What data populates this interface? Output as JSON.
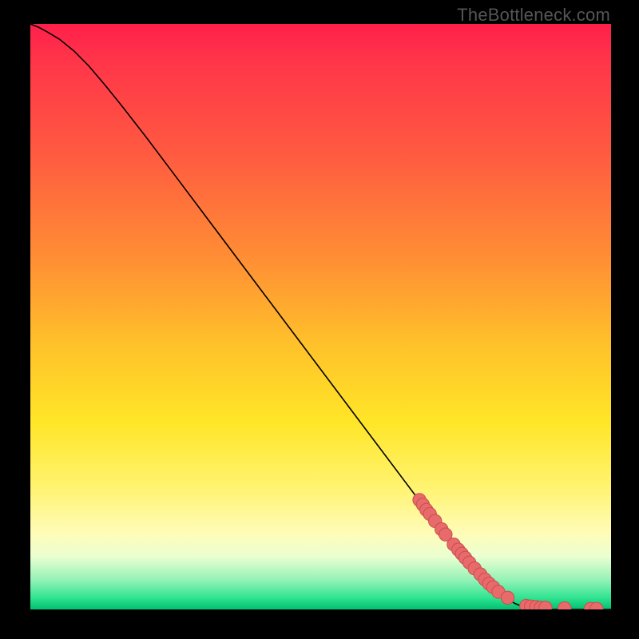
{
  "watermark": "TheBottleneck.com",
  "chart_data": {
    "type": "line",
    "title": "",
    "xlabel": "",
    "ylabel": "",
    "xlim": [
      0,
      1
    ],
    "ylim": [
      0,
      1
    ],
    "curve": [
      {
        "x": 0.0,
        "y": 1.0
      },
      {
        "x": 0.015,
        "y": 0.994
      },
      {
        "x": 0.03,
        "y": 0.986
      },
      {
        "x": 0.05,
        "y": 0.974
      },
      {
        "x": 0.075,
        "y": 0.954
      },
      {
        "x": 0.1,
        "y": 0.929
      },
      {
        "x": 0.13,
        "y": 0.894
      },
      {
        "x": 0.16,
        "y": 0.857
      },
      {
        "x": 0.2,
        "y": 0.806
      },
      {
        "x": 0.25,
        "y": 0.74
      },
      {
        "x": 0.3,
        "y": 0.674
      },
      {
        "x": 0.35,
        "y": 0.608
      },
      {
        "x": 0.4,
        "y": 0.542
      },
      {
        "x": 0.45,
        "y": 0.476
      },
      {
        "x": 0.5,
        "y": 0.41
      },
      {
        "x": 0.55,
        "y": 0.344
      },
      {
        "x": 0.6,
        "y": 0.278
      },
      {
        "x": 0.65,
        "y": 0.212
      },
      {
        "x": 0.7,
        "y": 0.146
      },
      {
        "x": 0.73,
        "y": 0.108
      },
      {
        "x": 0.76,
        "y": 0.073
      },
      {
        "x": 0.79,
        "y": 0.042
      },
      {
        "x": 0.815,
        "y": 0.021
      },
      {
        "x": 0.835,
        "y": 0.01
      },
      {
        "x": 0.85,
        "y": 0.004
      },
      {
        "x": 0.87,
        "y": 0.001
      },
      {
        "x": 0.9,
        "y": 0.0
      },
      {
        "x": 0.93,
        "y": 0.0
      },
      {
        "x": 0.96,
        "y": 0.0
      },
      {
        "x": 1.0,
        "y": 0.0
      }
    ],
    "scatter": [
      {
        "x": 0.67,
        "y": 0.187
      },
      {
        "x": 0.676,
        "y": 0.179
      },
      {
        "x": 0.682,
        "y": 0.17
      },
      {
        "x": 0.688,
        "y": 0.163
      },
      {
        "x": 0.697,
        "y": 0.151
      },
      {
        "x": 0.708,
        "y": 0.137
      },
      {
        "x": 0.715,
        "y": 0.128
      },
      {
        "x": 0.729,
        "y": 0.111
      },
      {
        "x": 0.737,
        "y": 0.102
      },
      {
        "x": 0.743,
        "y": 0.095
      },
      {
        "x": 0.749,
        "y": 0.088
      },
      {
        "x": 0.756,
        "y": 0.08
      },
      {
        "x": 0.765,
        "y": 0.07
      },
      {
        "x": 0.775,
        "y": 0.06
      },
      {
        "x": 0.783,
        "y": 0.051
      },
      {
        "x": 0.79,
        "y": 0.044
      },
      {
        "x": 0.797,
        "y": 0.038
      },
      {
        "x": 0.806,
        "y": 0.03
      },
      {
        "x": 0.822,
        "y": 0.02
      },
      {
        "x": 0.854,
        "y": 0.006
      },
      {
        "x": 0.862,
        "y": 0.005
      },
      {
        "x": 0.871,
        "y": 0.004
      },
      {
        "x": 0.879,
        "y": 0.003
      },
      {
        "x": 0.887,
        "y": 0.003
      },
      {
        "x": 0.92,
        "y": 0.002
      },
      {
        "x": 0.965,
        "y": 0.001
      },
      {
        "x": 0.975,
        "y": 0.001
      }
    ],
    "scatter_radius": 8.2
  }
}
